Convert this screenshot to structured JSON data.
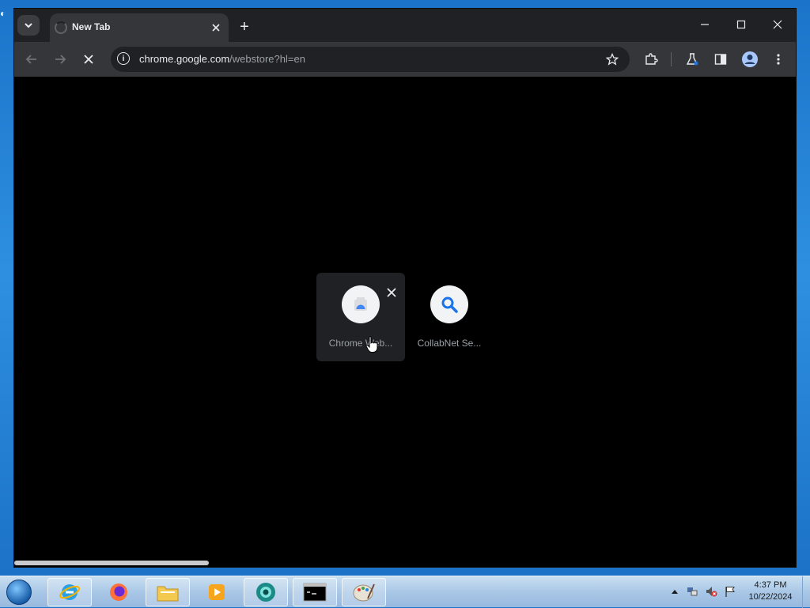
{
  "browser": {
    "tab": {
      "title": "New Tab"
    },
    "new_tab_label": "+",
    "address": {
      "url_host": "chrome.google.com",
      "url_path": "/webstore?hl=en"
    }
  },
  "shortcuts": [
    {
      "label": "Chrome Web..."
    },
    {
      "label": "CollabNet Se..."
    }
  ],
  "taskbar": {
    "clock_time": "4:37 PM",
    "clock_date": "10/22/2024"
  },
  "colors": {
    "tab_active": "#35363a",
    "tabstrip": "#202124",
    "content_bg": "#000000",
    "accent_blue": "#1a73e8"
  }
}
